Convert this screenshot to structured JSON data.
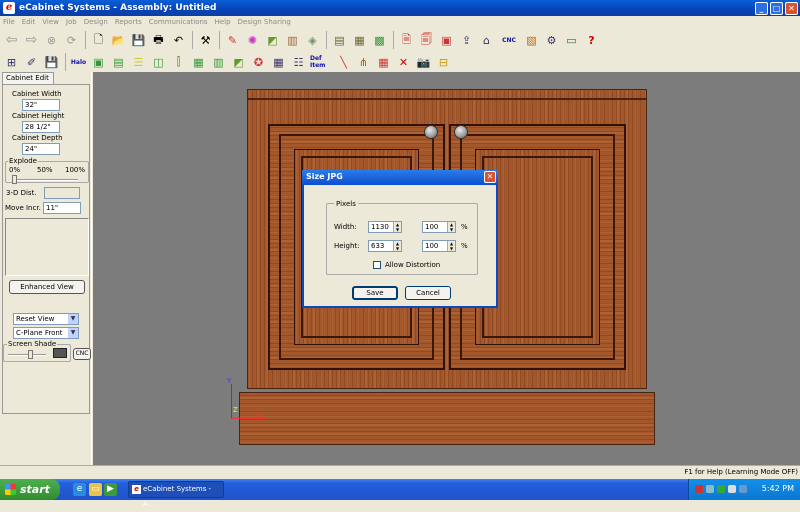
{
  "window": {
    "title": "eCabinet Systems - Assembly: Untitled",
    "app_glyph": "e",
    "min": "_",
    "max": "□",
    "close": "✕"
  },
  "menu": [
    "File",
    "Edit",
    "View",
    "Job",
    "Design",
    "Reports",
    "Communications",
    "Help",
    "Design Sharing"
  ],
  "toolbar1": {
    "icons": [
      "back-arrow-icon",
      "forward-arrow-icon",
      "stop-icon",
      "refresh-icon",
      "new-document-icon",
      "open-folder-icon",
      "save-icon",
      "print-icon",
      "undo-icon",
      "tools-icon",
      "paint-icon",
      "color-wheel-icon",
      "cabinet-view-icon",
      "door-icon",
      "panel-icon",
      "cabinet-icon",
      "cabinet-open-icon",
      "grid-icon",
      "report-icon",
      "report-money-icon",
      "report-list-icon",
      "upload-icon",
      "network-icon",
      "cnc-icon",
      "palette-icon",
      "settings-icon",
      "monitor-icon",
      "help-icon"
    ],
    "cnc_label": "CNC"
  },
  "toolbar2": {
    "halo_label": "Halo",
    "def_label": "Def Item",
    "labels": [
      "Halo",
      "Def\nItem"
    ]
  },
  "sidebar": {
    "tab": "Cabinet Edit",
    "width_label": "Cabinet Width",
    "width_value": "32\"",
    "height_label": "Cabinet Height",
    "height_value": "28 1/2\"",
    "depth_label": "Cabinet Depth",
    "depth_value": "24\"",
    "explode_label": "Explode",
    "explode_ticks": [
      "0%",
      "50%",
      "100%"
    ],
    "explode_level_percent": 0,
    "dist_label": "3-D Dist.",
    "dist_value": "",
    "move_label": "Move Incr.",
    "move_value": "11\"",
    "enhanced_view": "Enhanced View",
    "reset_view": "Reset View",
    "cplane": "C-Plane Front",
    "screen_shade": "Screen Shade",
    "cnc": "CNC"
  },
  "dialog": {
    "title": "Size JPG",
    "group": "Pixels",
    "width_label": "Width:",
    "width_px": "1130",
    "width_pct": "100",
    "height_label": "Height:",
    "height_px": "633",
    "height_pct": "100",
    "pct_symbol": "%",
    "distortion_label": "Allow Distortion",
    "save": "Save",
    "cancel": "Cancel",
    "close": "✕"
  },
  "status": {
    "text": "F1 for Help (Learning Mode OFF)"
  },
  "taskbar": {
    "start": "start",
    "task": "eCabinet Systems - A...",
    "clock": "5:42 PM"
  },
  "colors": {
    "title_blue": "#0842b5",
    "wood": "#a4572a",
    "viewport": "#7c7c7c",
    "taskbar": "#245edc"
  }
}
